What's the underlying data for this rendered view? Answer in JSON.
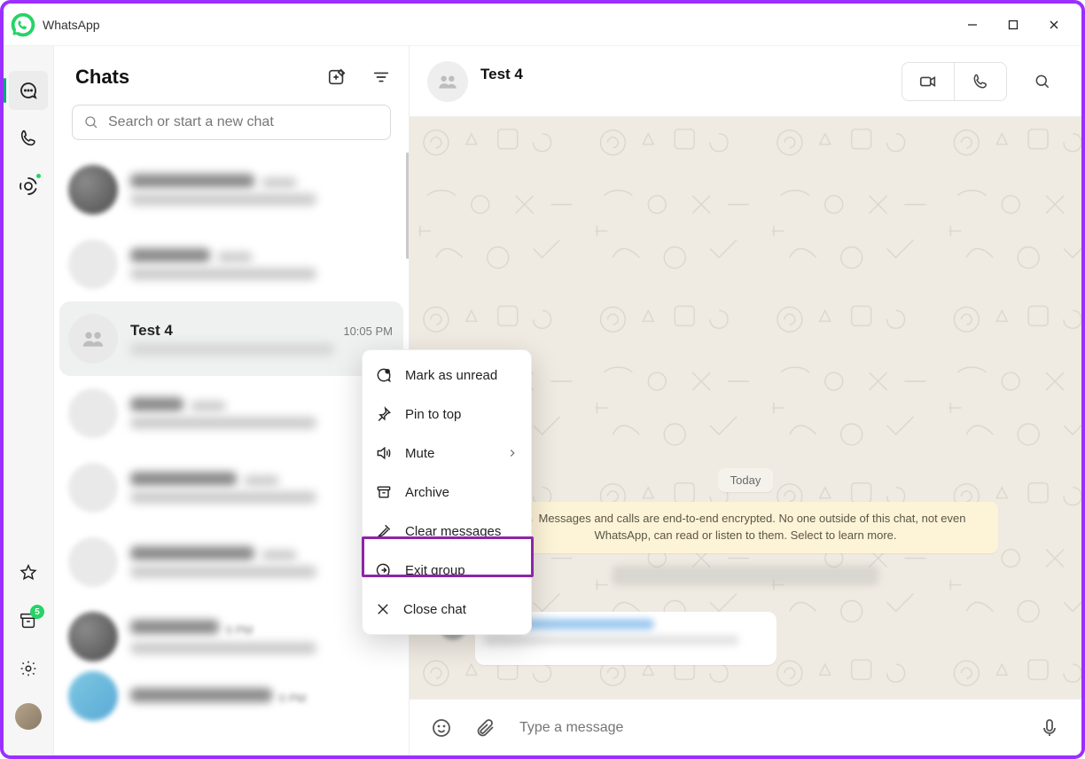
{
  "app_name": "WhatsApp",
  "window_buttons": {
    "min": "minimize",
    "max": "maximize",
    "close": "close"
  },
  "rail": {
    "items": [
      {
        "id": "chats",
        "active": true
      },
      {
        "id": "calls"
      },
      {
        "id": "status",
        "dot": true
      }
    ],
    "bottom": {
      "starred": "starred",
      "archive_badge": "5",
      "settings": "settings",
      "profile": "profile"
    }
  },
  "chatlist": {
    "title": "Chats",
    "search_placeholder": "Search or start a new chat",
    "selected": {
      "name": "Test 4",
      "time": "10:05 PM"
    }
  },
  "context_menu": {
    "items": [
      {
        "icon": "unread",
        "label": "Mark as unread"
      },
      {
        "icon": "pin",
        "label": "Pin to top"
      },
      {
        "icon": "mute",
        "label": "Mute",
        "submenu": true
      },
      {
        "icon": "archive",
        "label": "Archive"
      },
      {
        "icon": "clear",
        "label": "Clear messages"
      },
      {
        "icon": "exit",
        "label": "Exit group",
        "highlight": true
      },
      {
        "icon": "close",
        "label": "Close chat"
      }
    ]
  },
  "conversation": {
    "title": "Test 4",
    "date_label": "Today",
    "encryption_notice": "Messages and calls are end-to-end encrypted. No one outside of this chat, not even WhatsApp, can read or listen to them. Select to learn more."
  },
  "composer": {
    "placeholder": "Type a message"
  }
}
